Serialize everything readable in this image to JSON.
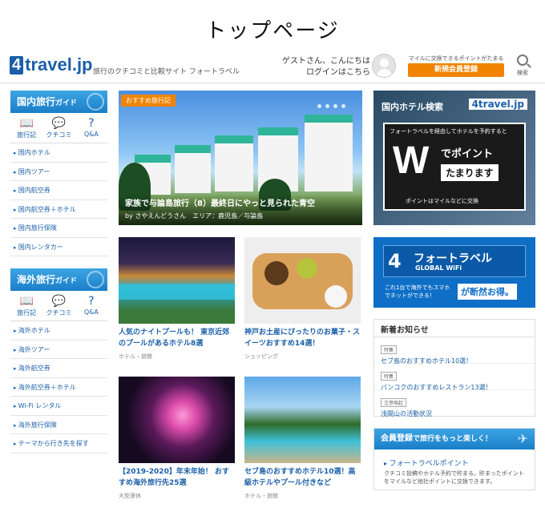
{
  "page_title": "トップページ",
  "header": {
    "logo_four": "4",
    "logo_text": "travel.jp",
    "tagline": "旅行のクチコミと比較サイト フォートラベル",
    "greeting": "ゲストさん、こんにちは",
    "login": "ログインはこちら",
    "mile_note": "マイルに交換できるポイントがたまる",
    "signup": "新規会員登録",
    "search_label": "検索"
  },
  "domestic": {
    "title": "国内旅行",
    "title_small": "ガイド",
    "icons": [
      {
        "label": "旅行記",
        "glyph": "📖"
      },
      {
        "label": "クチコミ",
        "glyph": "💬"
      },
      {
        "label": "Q&A",
        "glyph": "?"
      }
    ],
    "items": [
      "国内ホテル",
      "国内ツアー",
      "国内航空券",
      "国内航空券＋ホテル",
      "国内旅行保険",
      "国内レンタカー"
    ]
  },
  "overseas": {
    "title": "海外旅行",
    "title_small": "ガイド",
    "icons": [
      {
        "label": "旅行記",
        "glyph": "📖"
      },
      {
        "label": "クチコミ",
        "glyph": "💬"
      },
      {
        "label": "Q&A",
        "glyph": "?"
      }
    ],
    "items": [
      "海外ホテル",
      "海外ツアー",
      "海外航空券",
      "海外航空券＋ホテル",
      "Wi-Fi レンタル",
      "海外旅行保険",
      "テーマから行き先を探す"
    ]
  },
  "hero": {
    "badge": "おすすめ旅行記",
    "title": "家族で与論島旅行（8）最終日にやっと見られた青空",
    "byline": "by さやえんどうさん　エリア：鹿児島／与論島"
  },
  "cards": [
    {
      "title": "人気のナイトプールも！ 東京近郊のプールがあるホテル8選",
      "category": "ホテル・旅館"
    },
    {
      "title": "神戸お土産にぴったりのお菓子・スイーツおすすめ14選！",
      "category": "ショッピング"
    },
    {
      "title": "【2019-2020】年末年始！ おすすめ海外旅行先25選",
      "category": "大型連休"
    },
    {
      "title": "セブ島のおすすめホテル10選！高級ホテルやプール付きなど",
      "category": "ホテル・旅館"
    }
  ],
  "hotel_ad": {
    "heading": "国内ホテル検索",
    "logo": "4travel.jp",
    "line1": "フォートラベルを経由してホテルを予約すると",
    "big": "W",
    "de_point": "でポイント",
    "tamarimasu": "たまります",
    "line2": "ポイントはマイルなどに交換"
  },
  "wifi_ad": {
    "four": "4",
    "brand": "フォートラベル",
    "global": "GLOBAL WiFi",
    "sub": "これ1台で海外でもスマホでネットができる！",
    "promo": "が断然お得。"
  },
  "news": {
    "heading": "新着お知らせ",
    "items": [
      {
        "tag": "特集",
        "text": "セブ島のおすすめホテル10選！"
      },
      {
        "tag": "特集",
        "text": "バンコクのおすすめレストラン13選！"
      },
      {
        "tag": "注意喚起",
        "text": "浅間山の活動状況"
      }
    ]
  },
  "member": {
    "heading": "会員登録",
    "heading_rest": "で旅行をもっと楽しく！",
    "point_title": "フォートラベルポイント",
    "point_desc": "クチコミ投稿やホテル予約で貯まる。貯まったポイントをマイルなど他社ポイントに交換できます。"
  }
}
